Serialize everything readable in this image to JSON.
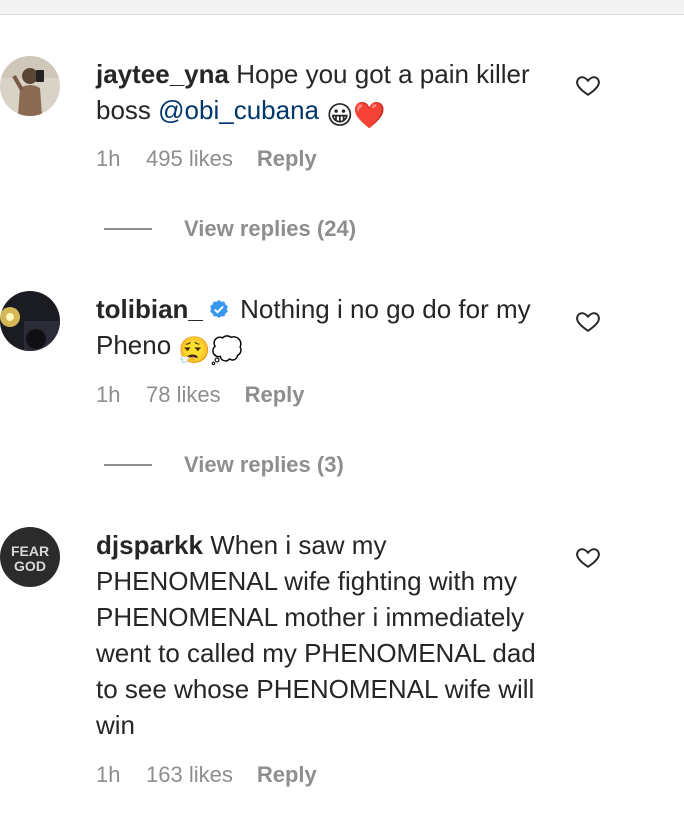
{
  "comments": [
    {
      "username": "jaytee_yna",
      "text": "Hope you got a pain killer boss ",
      "mention": "@obi_cubana",
      "emoji": "😀❤️",
      "time": "1h",
      "likes": "495 likes",
      "reply": "Reply",
      "view_replies": "View replies (24)"
    },
    {
      "username": "tolibian_",
      "verified": true,
      "text": "Nothing i no go do for my Pheno ",
      "emoji": "😮‍💨💭",
      "time": "1h",
      "likes": "78 likes",
      "reply": "Reply",
      "view_replies": "View replies (3)"
    },
    {
      "username": "djsparkk",
      "text": "When i saw my PHENOMENAL wife fighting with my PHENOMENAL mother i immediately went to called my PHENOMENAL dad to see whose PHENOMENAL wife will win",
      "time": "1h",
      "likes": "163 likes",
      "reply": "Reply",
      "avatar_text_line1": "FEAR",
      "avatar_text_line2": "GOD"
    }
  ],
  "colors": {
    "text": "#262626",
    "secondary": "#8e8e8e",
    "mention": "#00376b",
    "verified": "#3897f0"
  }
}
